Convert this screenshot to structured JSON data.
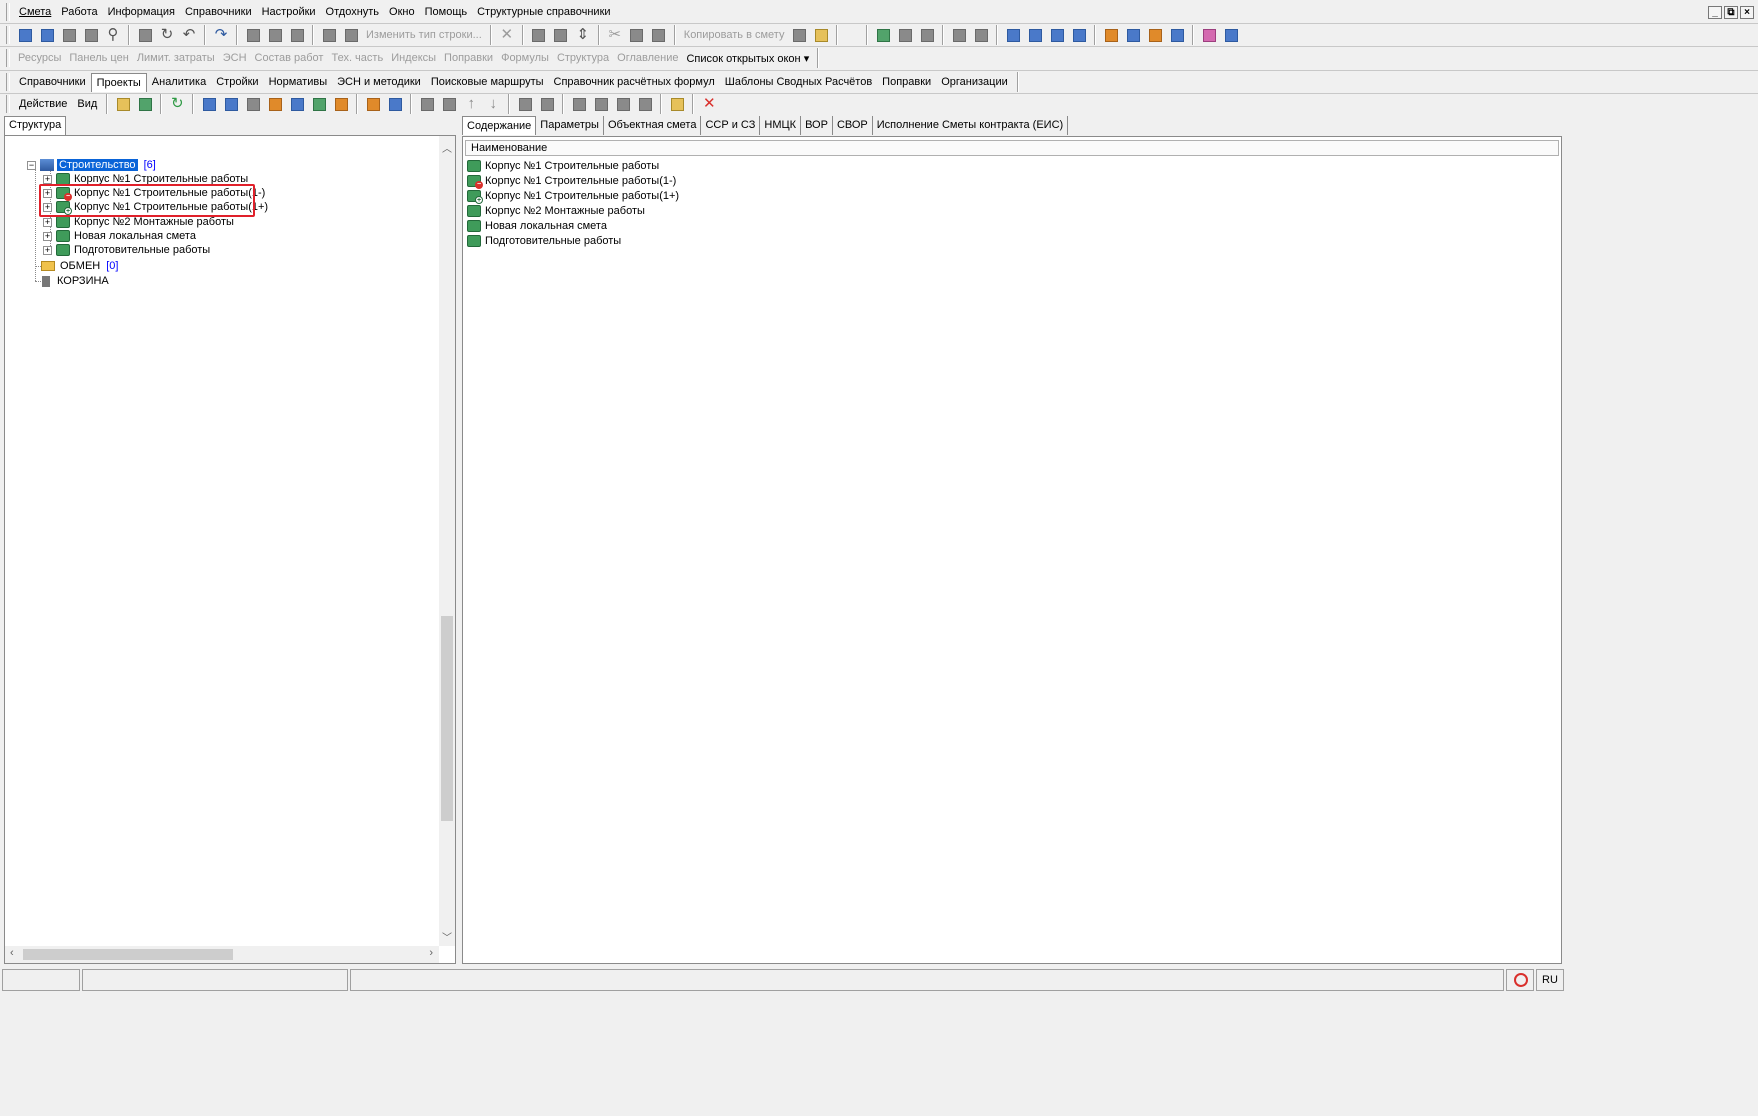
{
  "menu": {
    "items": [
      "Смета",
      "Работа",
      "Информация",
      "Справочники",
      "Настройки",
      "Отдохнуть",
      "Окно",
      "Помощь",
      "Структурные справочники"
    ],
    "window_controls": [
      "_",
      "⧉",
      "×"
    ]
  },
  "toolbar1": {
    "change_row_type": "Изменить тип строки...",
    "copy_to_estimate": "Копировать в смету"
  },
  "toolbar2": {
    "items": [
      "Ресурсы",
      "Панель цен",
      "Лимит. затраты",
      "ЭСН",
      "Состав работ",
      "Тех. часть",
      "Индексы",
      "Поправки",
      "Формулы",
      "Структура",
      "Оглавление"
    ],
    "open_windows": "Список открытых окон"
  },
  "tabs": {
    "items": [
      "Справочники",
      "Проекты",
      "Аналитика",
      "Стройки",
      "Нормативы",
      "ЭСН и методики",
      "Поисковые маршруты",
      "Справочник расчётных формул",
      "Шаблоны Сводных Расчётов",
      "Поправки",
      "Организации"
    ],
    "active": "Проекты"
  },
  "toolbar3": {
    "action": "Действие",
    "view": "Вид"
  },
  "left_panel": {
    "tab": "Структура",
    "root": {
      "label": "Строительство",
      "count": "[6]"
    },
    "children": [
      {
        "label": "Корпус №1 Строительные работы",
        "mark": ""
      },
      {
        "label": "Корпус №1 Строительные работы(1-)",
        "mark": "minus"
      },
      {
        "label": "Корпус №1 Строительные работы(1+)",
        "mark": "plus"
      },
      {
        "label": "Корпус №2 Монтажные работы",
        "mark": ""
      },
      {
        "label": "Новая локальная смета",
        "mark": ""
      },
      {
        "label": "Подготовительные работы",
        "mark": ""
      }
    ],
    "exchange": {
      "label": "ОБМЕН",
      "count": "[0]"
    },
    "trash": "КОРЗИНА"
  },
  "right_panel": {
    "tabs": [
      "Содержание",
      "Параметры",
      "Объектная смета",
      "ССР и СЗ",
      "НМЦК",
      "ВОР",
      "СВОР",
      "Исполнение Сметы контракта (ЕИС)"
    ],
    "active_tab": "Содержание",
    "column_header": "Наименование",
    "rows": [
      {
        "label": "Корпус №1 Строительные работы",
        "mark": ""
      },
      {
        "label": "Корпус №1 Строительные работы(1-)",
        "mark": "minus"
      },
      {
        "label": "Корпус №1 Строительные работы(1+)",
        "mark": "plus"
      },
      {
        "label": "Корпус №2 Монтажные работы",
        "mark": ""
      },
      {
        "label": "Новая локальная смета",
        "mark": ""
      },
      {
        "label": "Подготовительные работы",
        "mark": ""
      }
    ]
  },
  "statusbar": {
    "language": "RU"
  },
  "colors": {
    "selection": "#0a64d8",
    "highlight_box": "#e0202a",
    "estimate_icon": "#3f9b5a"
  }
}
